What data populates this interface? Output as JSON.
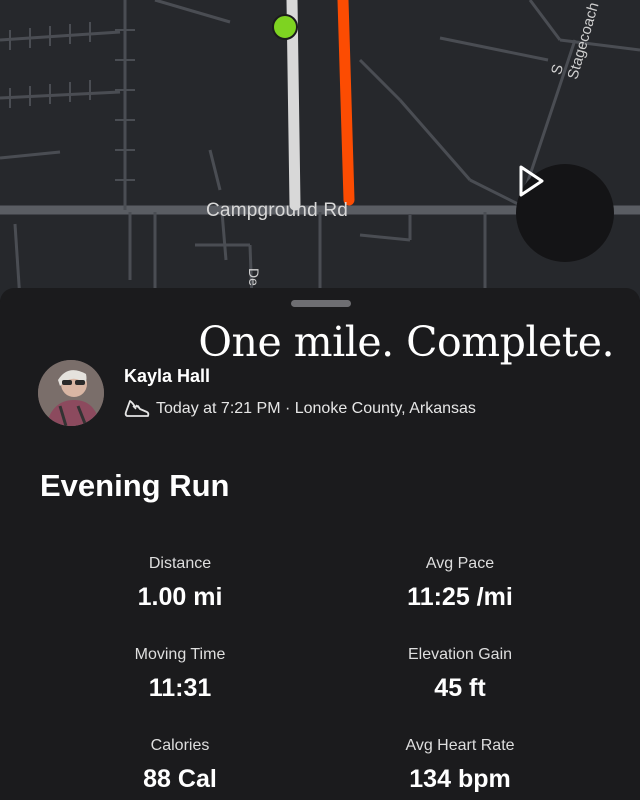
{
  "map": {
    "road_label": "Campground Rd",
    "side_road_label": "S Stagecoach",
    "short_road_label": "De",
    "route_color": "#fc4c02",
    "start_marker_color": "#7ed321",
    "play_icon": "play-icon"
  },
  "header": {
    "headline": "One mile. Complete."
  },
  "athlete": {
    "name": "Kayla Hall",
    "activity_icon": "shoe-icon",
    "meta": "Today at 7:21 PM · Lonoke County, Arkansas"
  },
  "activity": {
    "title": "Evening Run"
  },
  "stats": [
    {
      "label": "Distance",
      "value": "1.00 mi"
    },
    {
      "label": "Avg Pace",
      "value": "11:25 /mi"
    },
    {
      "label": "Moving Time",
      "value": "11:31"
    },
    {
      "label": "Elevation Gain",
      "value": "45 ft"
    },
    {
      "label": "Calories",
      "value": "88 Cal"
    },
    {
      "label": "Avg Heart Rate",
      "value": "134 bpm"
    }
  ]
}
